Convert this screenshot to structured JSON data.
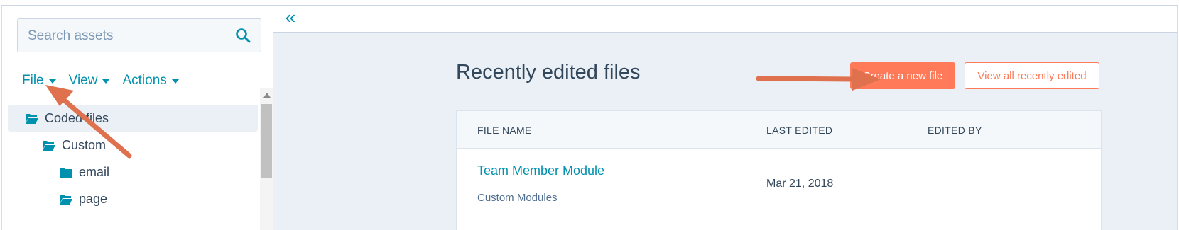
{
  "sidebar": {
    "search": {
      "placeholder": "Search assets"
    },
    "menu": [
      {
        "label": "File"
      },
      {
        "label": "View"
      },
      {
        "label": "Actions"
      }
    ],
    "tree": [
      {
        "label": "Coded files",
        "level": 0,
        "selected": true,
        "open": true
      },
      {
        "label": "Custom",
        "level": 1,
        "selected": false,
        "open": true
      },
      {
        "label": "email",
        "level": 2,
        "selected": false,
        "open": false
      },
      {
        "label": "page",
        "level": 2,
        "selected": false,
        "open": true
      }
    ]
  },
  "main": {
    "collapse_icon": "«",
    "title": "Recently edited files",
    "create_button": "Create a new file",
    "view_all_button": "View all recently edited",
    "table": {
      "columns": [
        "FILE NAME",
        "LAST EDITED",
        "EDITED BY"
      ],
      "rows": [
        {
          "name": "Team Member Module",
          "subtitle": "Custom Modules",
          "last_edited": "Mar 21, 2018",
          "edited_by": ""
        }
      ]
    }
  },
  "colors": {
    "accent": "#0091ae",
    "primary": "#ff7a59",
    "text": "#33475b",
    "arrow": "#e0714f"
  }
}
